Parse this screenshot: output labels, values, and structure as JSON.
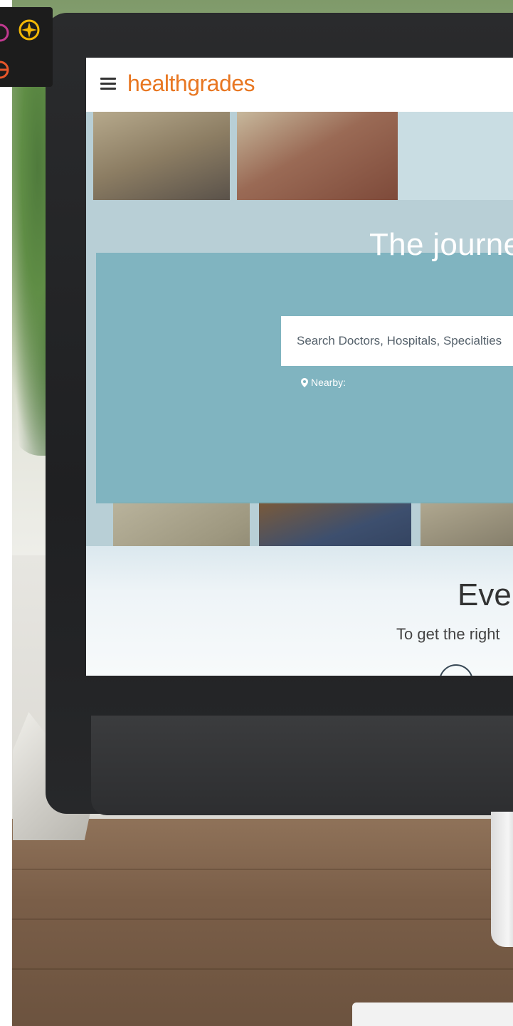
{
  "app": {
    "logo_text": "healthgrades",
    "brand_color": "#e87722"
  },
  "hero": {
    "headline": "The journe",
    "search": {
      "placeholder": "Search Doctors, Hospitals, Specialties"
    },
    "nearby_label": "Nearby:"
  },
  "section": {
    "heading": "Ever",
    "subtext": "To get the right"
  },
  "icons": {
    "menu": "hamburger-icon",
    "location": "map-pin-icon",
    "badge": [
      "compass-icon",
      "circle-icon"
    ]
  }
}
